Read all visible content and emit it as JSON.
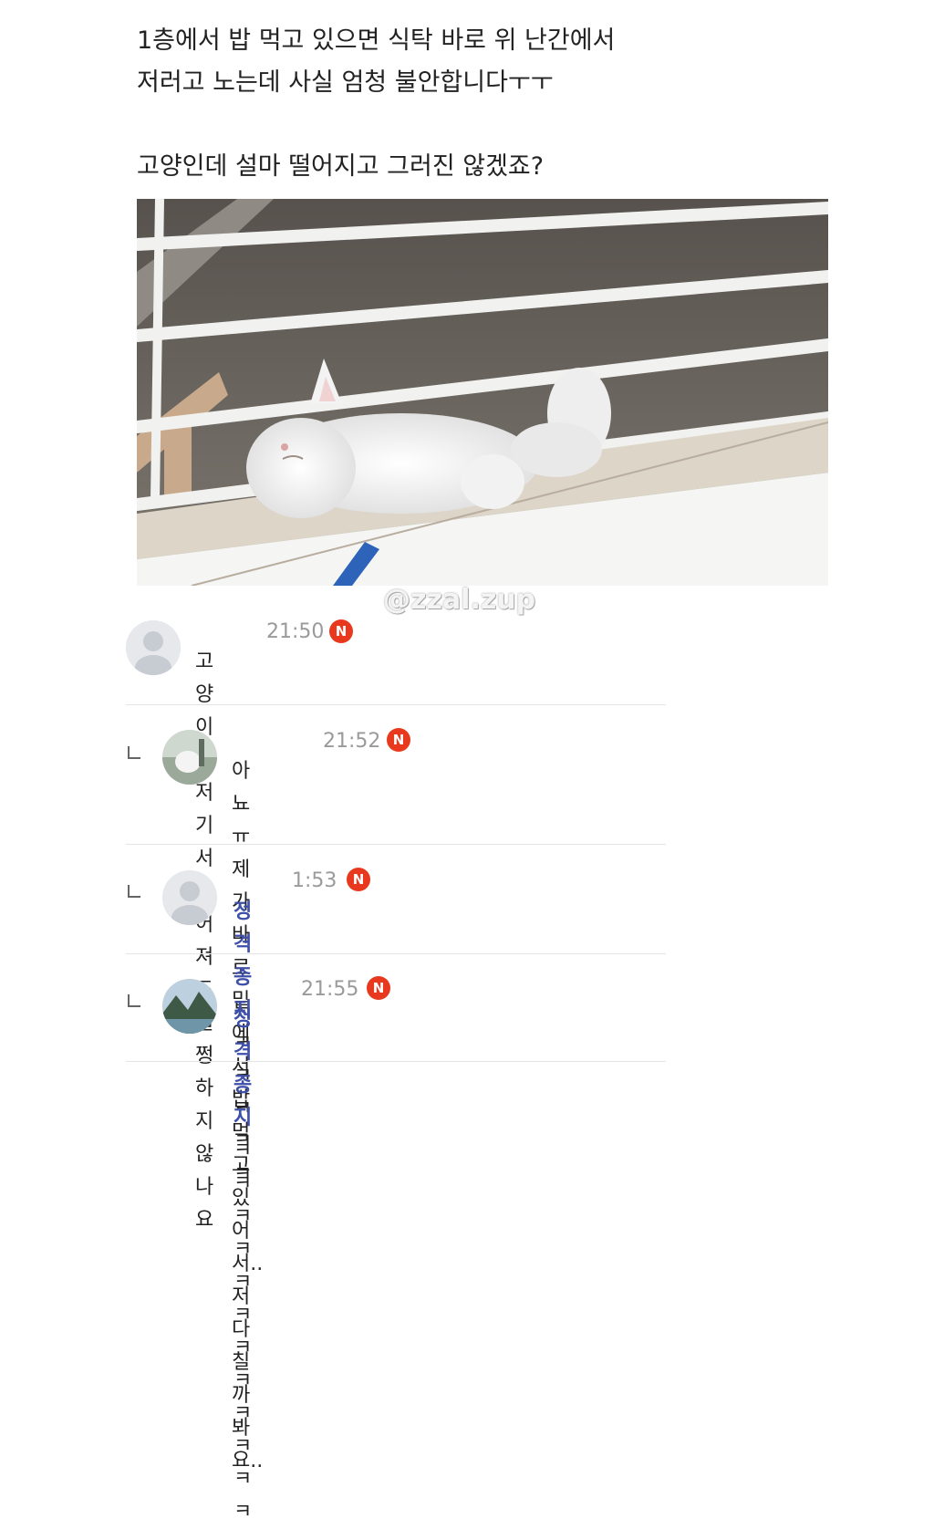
{
  "post": {
    "line1": "1층에서 밥 먹고 있으면 식탁 바로 위 난간에서",
    "line2": "저러고 노는데 사실 엄청 불안합니다ㅜㅜ",
    "line3": "고양인데 설마 떨어지고 그러진 않겠죠?"
  },
  "watermark": "@zzal.zup",
  "badge_label": "N",
  "colors": {
    "badge": "#e8391e",
    "author": "#3d4fa8",
    "meta": "#9a9a9a"
  },
  "comments": [
    {
      "time": "21:50",
      "author": "",
      "text": "고양이는 저기서 떨어져도 멀쩡하지 않나요",
      "avatar_icon": "default-user-icon"
    },
    {
      "time": "21:52",
      "author": "",
      "text_line1": "아뇨ㅠ 제가 바로 밑에서 밥먹고 있어서.. 저",
      "text_line2": "다칠까봐요..",
      "avatar_icon": "photo-avatar-icon"
    },
    {
      "time": "1:53",
      "author": "정격종지",
      "text": "ㅋㅋㅋㅋㅋ",
      "avatar_icon": "default-user-icon"
    },
    {
      "time": "21:55",
      "author": "정격종지",
      "text": "ㅋㅋㅋㅋㅋㅋㅋㅋㅋㅋㅋㅋ",
      "avatar_icon": "landscape-avatar-icon"
    }
  ]
}
